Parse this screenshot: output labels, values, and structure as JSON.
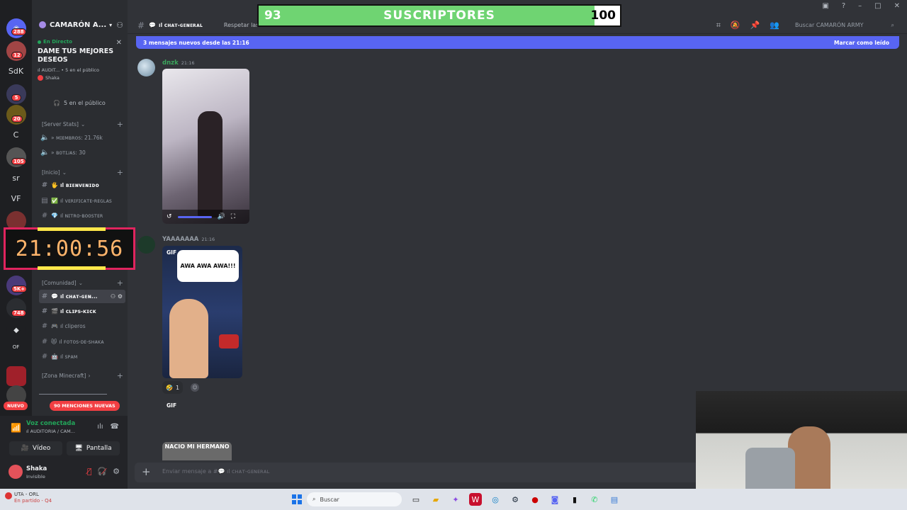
{
  "server_rail": {
    "items": [
      {
        "label": "",
        "badge": "288"
      },
      {
        "label": "",
        "badge": "12"
      },
      {
        "label": "SdK",
        "badge": ""
      },
      {
        "label": "",
        "badge": "5"
      },
      {
        "label": "",
        "badge": "20"
      },
      {
        "label": "C",
        "badge": ""
      },
      {
        "label": "",
        "badge": "105"
      },
      {
        "label": "sr",
        "badge": ""
      },
      {
        "label": "VF",
        "badge": ""
      },
      {
        "label": "",
        "badge": "5K+"
      },
      {
        "label": "",
        "badge": "748"
      },
      {
        "label": "OF",
        "badge": ""
      }
    ],
    "new_label": "NUEVO"
  },
  "server": {
    "name": "CAMARÓN A..."
  },
  "stage": {
    "live_label": "En Directo",
    "title": "DAME TUS MEJORES DESEOS",
    "meta": "ıl AUDIT... • 5 en el público",
    "host": "Shaka",
    "audience": "5 en el público"
  },
  "categories": {
    "stats": "[Server Stats]",
    "inicio": "[Inicio]",
    "comunidad": "[Comunidad]",
    "minecraft": "[Zona Minecraft]"
  },
  "channels": {
    "stats": [
      {
        "label": "» ᴍɪᴇᴍʙʀᴏs: 21.76k"
      },
      {
        "label": "» ʙᴏᴛɪᴊᴀs: 30"
      }
    ],
    "inicio": [
      {
        "emoji": "🖐",
        "label": "ıl ʙɪᴇɴᴠᴇɴɪᴅᴏ"
      },
      {
        "emoji": "✅",
        "label": "ıl ᴠᴇʀɪꜰɪᴄᴀᴛᴇ-ʀᴇɢʟᴀs"
      },
      {
        "emoji": "💎",
        "label": "ıl ɴɪᴛʀᴏ-ʙᴏᴏsᴛᴇʀ"
      }
    ],
    "comunidad": [
      {
        "emoji": "💬",
        "label": "ıl ᴄʜᴀᴛ-ɢᴇɴ..."
      },
      {
        "emoji": "🎬",
        "label": "ıl ᴄʟɪᴘs-ᴋɪᴄᴋ"
      },
      {
        "emoji": "🎮",
        "label": "ıl cliperos"
      },
      {
        "emoji": "😻",
        "label": "ıl ꜰᴏᴛᴏs-ᴅᴇ-sʜᴀᴋᴀ"
      },
      {
        "emoji": "🤖",
        "label": "ıl sᴘᴀᴍ"
      }
    ]
  },
  "mentions_pill": "90 MENCIONES NUEVAS",
  "voice": {
    "status": "Voz conectada",
    "channel": "ıl AUDITORIA / CAM...",
    "video_label": "Vídeo",
    "screen_label": "Pantalla"
  },
  "user": {
    "name": "Shaka",
    "status": "Invisible"
  },
  "topbar": {
    "channel": "ıl ᴄʜᴀᴛ-ɢᴇɴᴇʀᴀʟ",
    "topic": "Respetar las r",
    "search_placeholder": "Buscar CAMARÓN ARMY"
  },
  "new_messages": {
    "text": "3 mensajes nuevos desde las 21:16",
    "action": "Marcar como leído"
  },
  "messages": [
    {
      "author": "dnzk",
      "time": "21:16",
      "color": "#3ba55c"
    },
    {
      "author": "YAAAAAAA",
      "time": "21:16",
      "color": "#949ba4"
    }
  ],
  "gif": {
    "tag": "GIF",
    "caption": "AWA AWA AWA!!!"
  },
  "reaction": {
    "emoji": "🤣",
    "count": "1"
  },
  "gif_tag2": "GIF",
  "last_media_caption": "NACIO MI HERMANO",
  "composer": {
    "placeholder": "Enviar mensaje a #💬 ıl ᴄʜᴀᴛ-ɢᴇɴᴇʀᴀʟ"
  },
  "subs_overlay": {
    "current": "93",
    "label": "SUSCRIPTORES",
    "goal": "100",
    "progress": 0.93
  },
  "clock": {
    "time": "21:00:56"
  },
  "taskbar": {
    "game_title": "UTA - ORL",
    "game_status": "En partido - Q4",
    "search_placeholder": "Buscar"
  }
}
